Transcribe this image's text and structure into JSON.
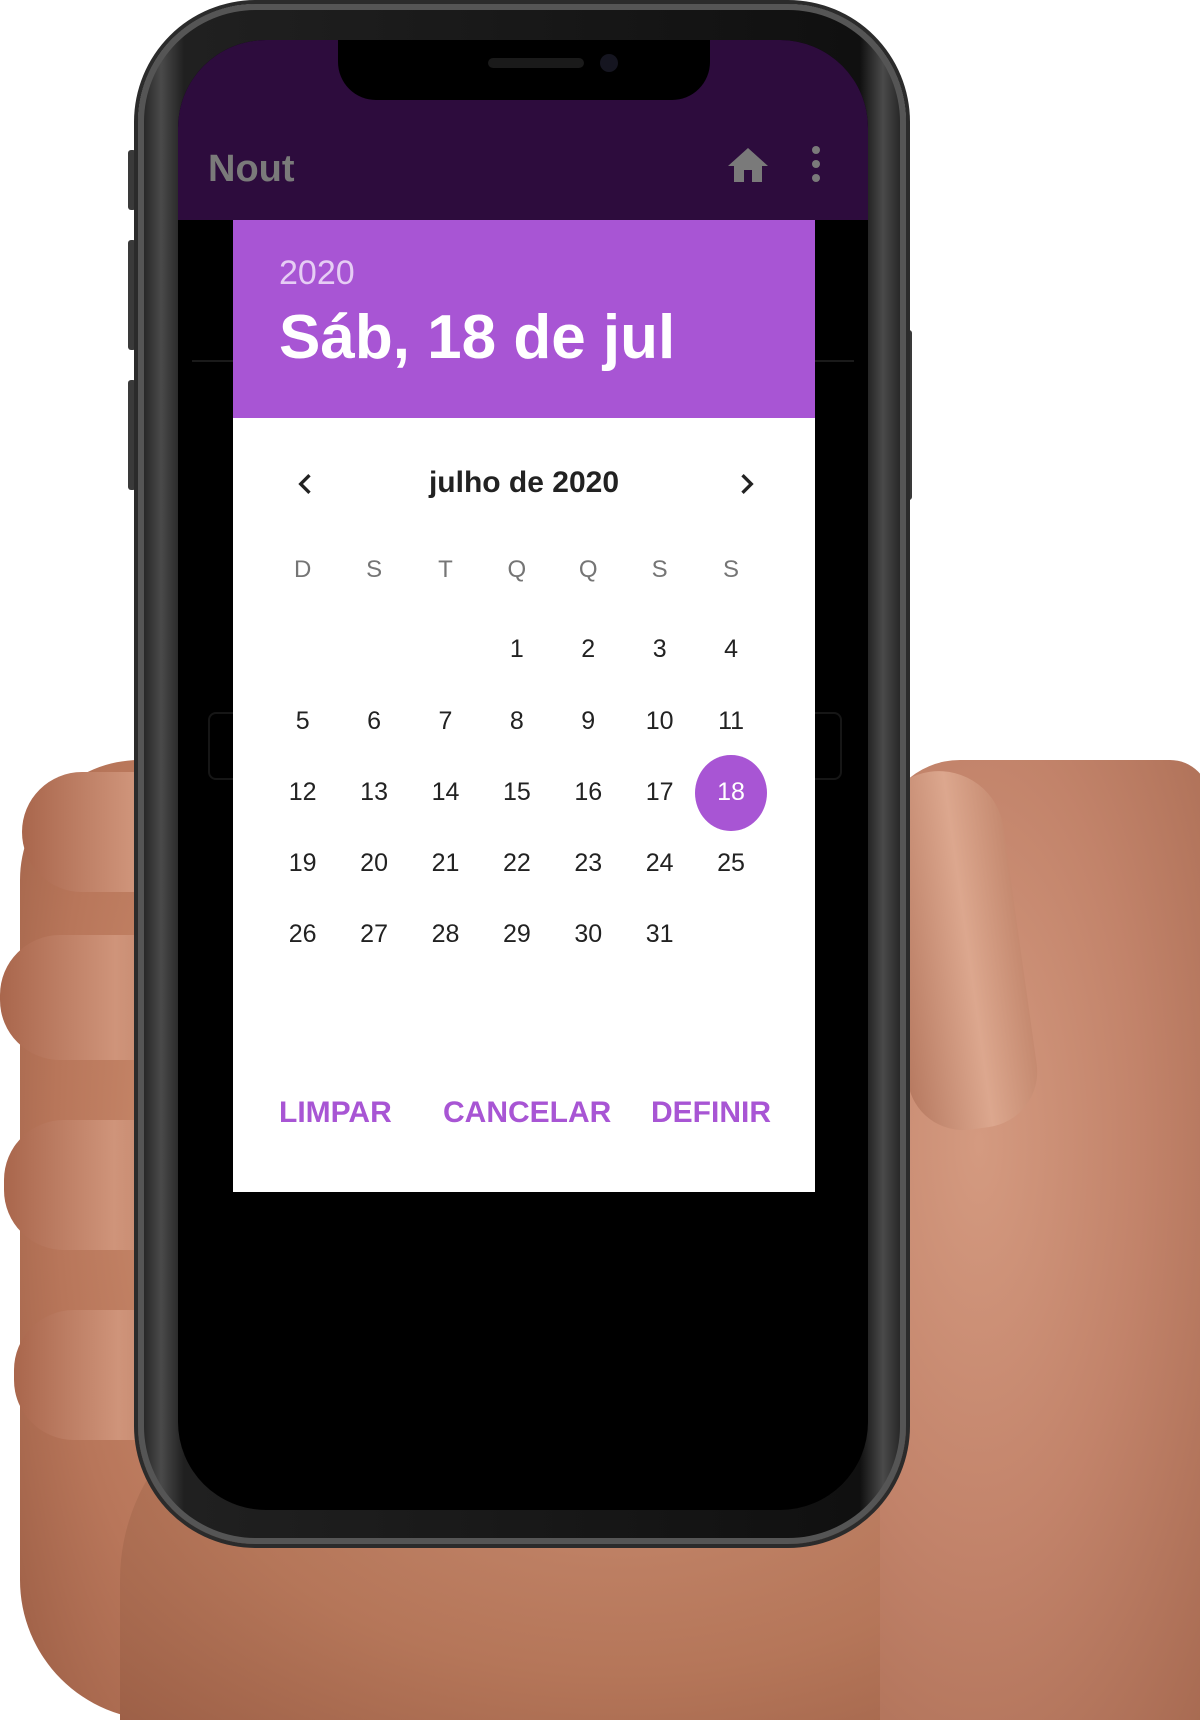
{
  "app": {
    "title": "Nout",
    "icons": [
      "home-icon",
      "more-vert-icon"
    ]
  },
  "date_picker": {
    "year": "2020",
    "selected_date_label": "Sáb, 18 de jul",
    "month_label": "julho de 2020",
    "weekdays": [
      "D",
      "S",
      "T",
      "Q",
      "Q",
      "S",
      "S"
    ],
    "weeks": [
      [
        "",
        "",
        "",
        "1",
        "2",
        "3",
        "4"
      ],
      [
        "5",
        "6",
        "7",
        "8",
        "9",
        "10",
        "11"
      ],
      [
        "12",
        "13",
        "14",
        "15",
        "16",
        "17",
        "18"
      ],
      [
        "19",
        "20",
        "21",
        "22",
        "23",
        "24",
        "25"
      ],
      [
        "26",
        "27",
        "28",
        "29",
        "30",
        "31",
        ""
      ]
    ],
    "selected_day": "18",
    "actions": {
      "clear": "LIMPAR",
      "cancel": "CANCELAR",
      "set": "DEFINIR"
    },
    "accent_color": "#a855d4"
  },
  "colors": {
    "app_bar": "#2d0c3d",
    "screen_bg": "#000000",
    "dialog_bg": "#ffffff"
  }
}
